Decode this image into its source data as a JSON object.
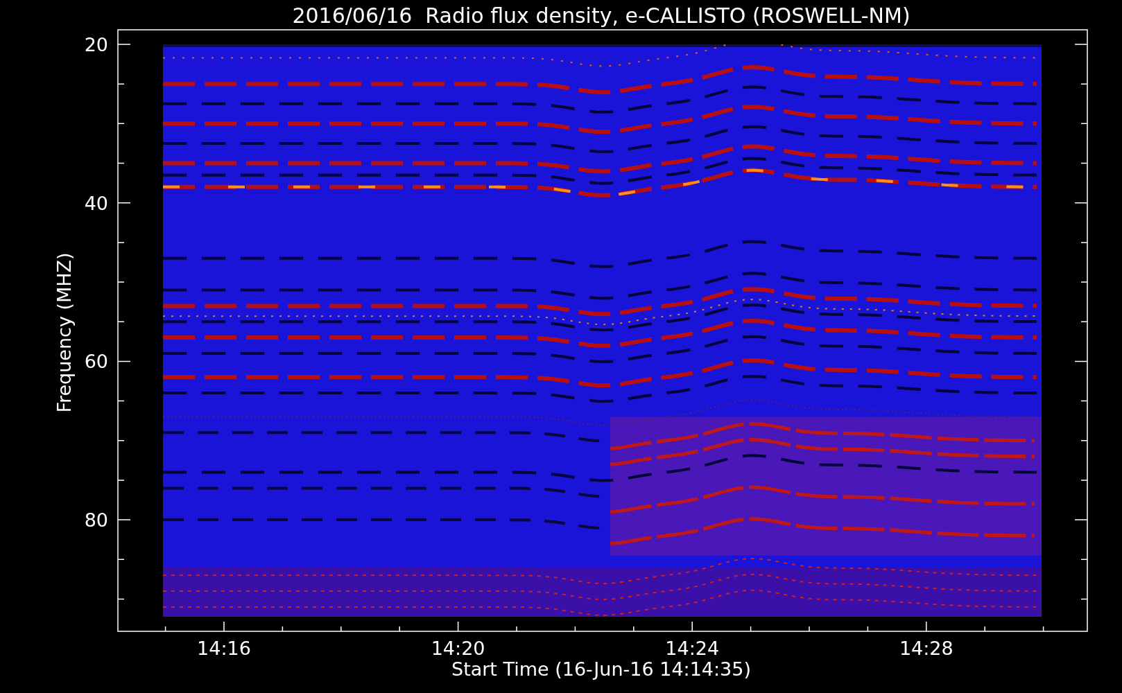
{
  "title": "2016/06/16  Radio flux density, e-CALLISTO (ROSWELL-NM)",
  "xlabel": "Start Time (16-Jun-16 14:14:35)",
  "ylabel": "Frequency (MHZ)",
  "xticks": [
    "14:16",
    "14:20",
    "14:24",
    "14:28"
  ],
  "yticks": [
    "20",
    "40",
    "60",
    "80"
  ]
}
